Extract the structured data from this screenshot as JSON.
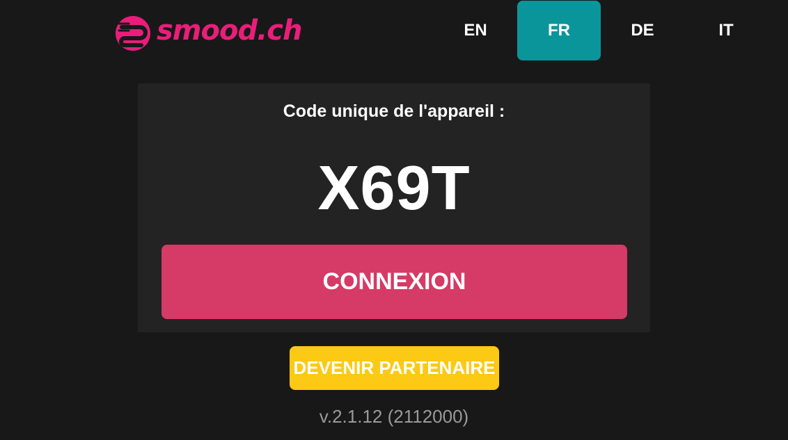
{
  "brand": {
    "name": "smood.ch",
    "color": "#e91e7a"
  },
  "languages": [
    {
      "label": "EN",
      "active": false
    },
    {
      "label": "FR",
      "active": true
    },
    {
      "label": "DE",
      "active": false
    },
    {
      "label": "IT",
      "active": false
    }
  ],
  "device": {
    "label": "Code unique de l'appareil :",
    "code": "X69T"
  },
  "actions": {
    "login_label": "CONNEXION",
    "partner_label": "DEVENIR PARTENAIRE"
  },
  "version": "v.2.1.12 (2112000)",
  "colors": {
    "background": "#181818",
    "card": "#232323",
    "active_language": "#0a959b",
    "login_button": "#d63a66",
    "partner_button": "#fcc914"
  }
}
